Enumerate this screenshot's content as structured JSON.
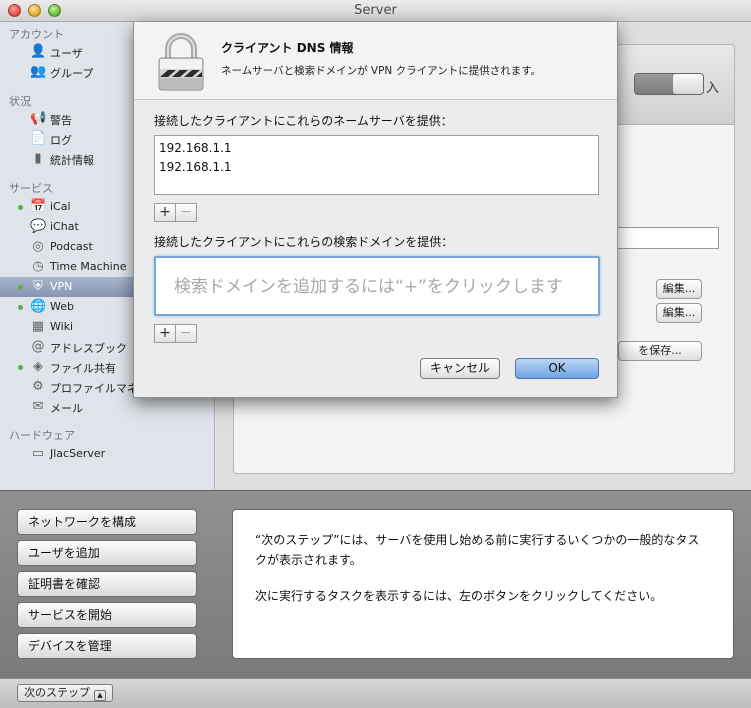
{
  "window": {
    "title": "Server"
  },
  "sidebar": {
    "groups": {
      "accounts": "アカウント",
      "status": "状況",
      "services": "サービス",
      "hardware": "ハードウェア"
    },
    "items": {
      "users": "ユーザ",
      "groups": "グループ",
      "alerts": "警告",
      "logs": "ログ",
      "stats": "統計情報",
      "ical": "iCal",
      "ichat": "iChat",
      "podcast": "Podcast",
      "timemachine": "Time Machine",
      "vpn": "VPN",
      "web": "Web",
      "wiki": "Wiki",
      "addressbook": "アドレスブック",
      "filesharing": "ファイル共有",
      "profilemanager": "プロファイルマネージャ",
      "mail": "メール",
      "server": "JlacServer"
    }
  },
  "main_bg": {
    "toggle_label": "入",
    "edit_label": "編集...",
    "save_profile_label": "を保存..."
  },
  "sheet": {
    "title": "クライアント DNS 情報",
    "subtitle": "ネームサーバと検索ドメインが VPN クライアントに提供されます。",
    "nameservers_label": "接続したクライアントにこれらのネームサーバを提供：",
    "nameservers": [
      "192.168.1.1",
      "192.168.1.1"
    ],
    "domains_label": "接続したクライアントにこれらの検索ドメインを提供：",
    "domains_placeholder": "検索ドメインを追加するには“+”をクリックします",
    "plus": "+",
    "minus": "−",
    "cancel_label": "キャンセル",
    "ok_label": "OK"
  },
  "steps": {
    "buttons": [
      "ネットワークを構成",
      "ユーザを追加",
      "証明書を確認",
      "サービスを開始",
      "デバイスを管理"
    ],
    "info_p1": "“次のステップ”には、サーバを使用し始める前に実行するいくつかの一般的なタスクが表示されます。",
    "info_p2": "次に実行するタスクを表示するには、左のボタンをクリックしてください。"
  },
  "footer": {
    "next_steps_label": "次のステップ",
    "chevron": "▲"
  },
  "colors": {
    "accent": "#6fa3e2",
    "selection": "#8696b2",
    "status_dot": "#58b141"
  }
}
